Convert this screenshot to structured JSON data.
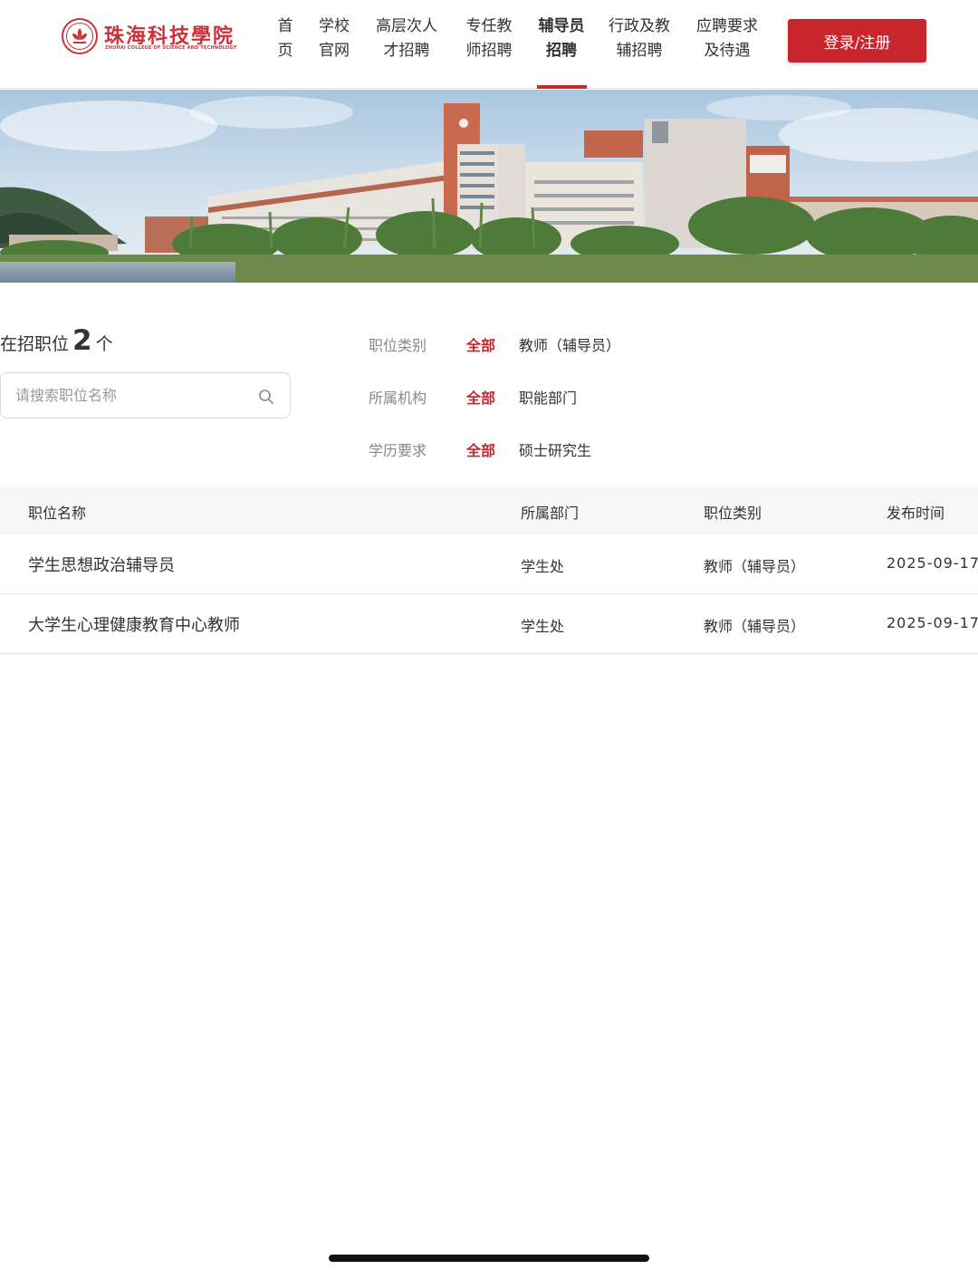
{
  "header": {
    "logo": {
      "name_cn": "珠海科技學院",
      "name_en": "ZHUHAI COLLEGE OF SCIENCE AND TECHNOLOGY"
    },
    "nav": [
      {
        "line1": "首",
        "line2": "页"
      },
      {
        "line1": "学校",
        "line2": "官网"
      },
      {
        "line1": "高层次人",
        "line2": "才招聘"
      },
      {
        "line1": "专任教",
        "line2": "师招聘"
      },
      {
        "line1": "辅导员",
        "line2": "招聘",
        "active": true
      },
      {
        "line1": "行政及教",
        "line2": "辅招聘"
      },
      {
        "line1": "应聘要求",
        "line2": "及待遇"
      }
    ],
    "login_label": "登录/注册"
  },
  "filters": {
    "count_prefix": "在招职位",
    "count": "2",
    "count_suffix": "个",
    "search_placeholder": "请搜索职位名称",
    "rows": [
      {
        "label": "职位类别",
        "all": "全部",
        "option": "教师（辅导员）"
      },
      {
        "label": "所属机构",
        "all": "全部",
        "option": "职能部门"
      },
      {
        "label": "学历要求",
        "all": "全部",
        "option": "硕士研究生"
      }
    ]
  },
  "table": {
    "headers": [
      "职位名称",
      "所属部门",
      "职位类别",
      "发布时间"
    ],
    "rows": [
      {
        "title": "学生思想政治辅导员",
        "dept": "学生处",
        "category": "教师（辅导员）",
        "date": "2025-09-17"
      },
      {
        "title": "大学生心理健康教育中心教师",
        "dept": "学生处",
        "category": "教师（辅导员）",
        "date": "2025-09-17"
      }
    ]
  },
  "colors": {
    "accent": "#c9252c",
    "header_bg": "#f6f6f6"
  }
}
